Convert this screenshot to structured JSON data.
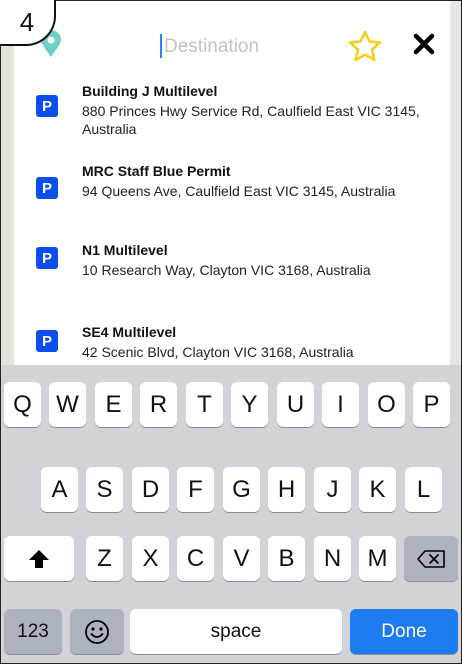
{
  "step_badge": "4",
  "search": {
    "placeholder": "Destination",
    "value": ""
  },
  "results": [
    {
      "badge": "P",
      "title": "Building J Multilevel",
      "address": "880 Princes Hwy Service Rd, Caulfield East VIC 3145, Australia"
    },
    {
      "badge": "P",
      "title": "MRC Staff Blue Permit",
      "address": "94 Queens Ave, Caulfield East VIC 3145, Australia"
    },
    {
      "badge": "P",
      "title": "N1 Multilevel",
      "address": "10 Research Way, Clayton VIC 3168, Australia"
    },
    {
      "badge": "P",
      "title": "SE4 Multilevel",
      "address": "42 Scenic Blvd, Clayton VIC 3168, Australia"
    }
  ],
  "keyboard": {
    "row1": [
      "Q",
      "W",
      "E",
      "R",
      "T",
      "Y",
      "U",
      "I",
      "O",
      "P"
    ],
    "row2": [
      "A",
      "S",
      "D",
      "F",
      "G",
      "H",
      "J",
      "K",
      "L"
    ],
    "row3": [
      "Z",
      "X",
      "C",
      "V",
      "B",
      "N",
      "M"
    ],
    "numbers_label": "123",
    "space_label": "space",
    "done_label": "Done"
  },
  "colors": {
    "accent": "#1d7cf2",
    "parking_badge": "#0b4ef0",
    "star": "#f5cf1b",
    "pin": "#6fcfc3"
  }
}
